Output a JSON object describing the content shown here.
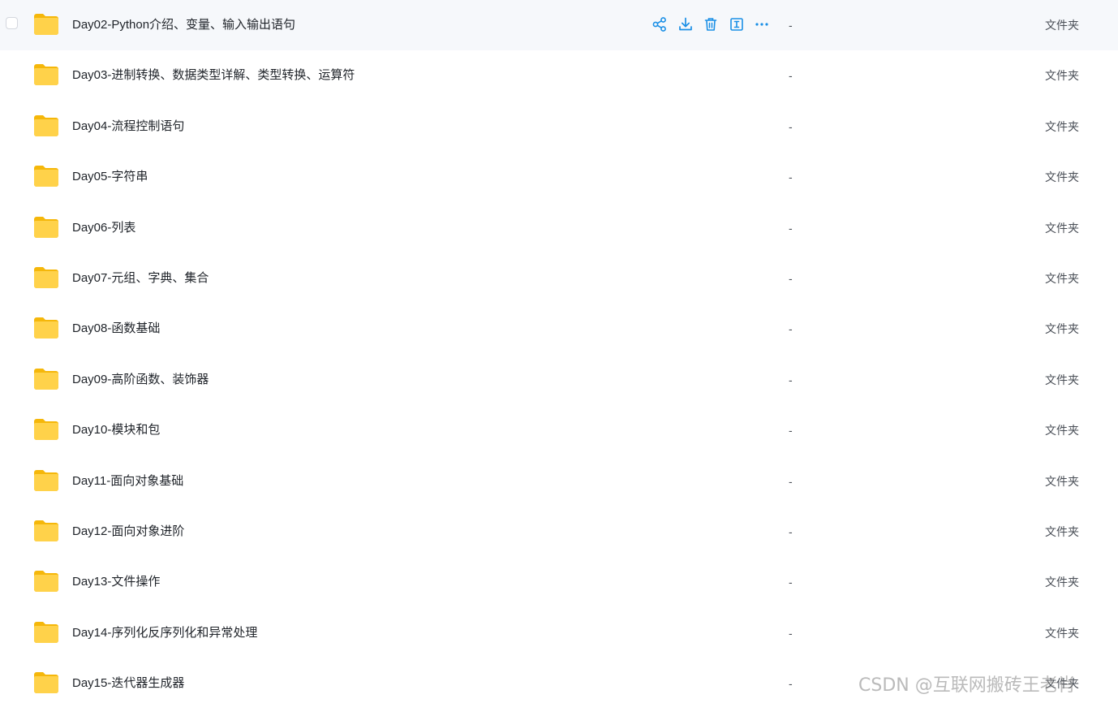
{
  "rows": [
    {
      "name": "Day02-Python介绍、变量、输入输出语句",
      "size": "-",
      "type": "文件夹"
    },
    {
      "name": "Day03-进制转换、数据类型详解、类型转换、运算符",
      "size": "-",
      "type": "文件夹"
    },
    {
      "name": "Day04-流程控制语句",
      "size": "-",
      "type": "文件夹"
    },
    {
      "name": "Day05-字符串",
      "size": "-",
      "type": "文件夹"
    },
    {
      "name": "Day06-列表",
      "size": "-",
      "type": "文件夹"
    },
    {
      "name": "Day07-元组、字典、集合",
      "size": "-",
      "type": "文件夹"
    },
    {
      "name": "Day08-函数基础",
      "size": "-",
      "type": "文件夹"
    },
    {
      "name": "Day09-高阶函数、装饰器",
      "size": "-",
      "type": "文件夹"
    },
    {
      "name": "Day10-模块和包",
      "size": "-",
      "type": "文件夹"
    },
    {
      "name": "Day11-面向对象基础",
      "size": "-",
      "type": "文件夹"
    },
    {
      "name": "Day12-面向对象进阶",
      "size": "-",
      "type": "文件夹"
    },
    {
      "name": "Day13-文件操作",
      "size": "-",
      "type": "文件夹"
    },
    {
      "name": "Day14-序列化反序列化和异常处理",
      "size": "-",
      "type": "文件夹"
    },
    {
      "name": "Day15-迭代器生成器",
      "size": "-",
      "type": "文件夹"
    }
  ],
  "hovered_row_actions": [
    "share-icon",
    "download-icon",
    "delete-icon",
    "rename-icon",
    "more-icon"
  ],
  "colors": {
    "accent": "#1a8fe6",
    "folder": "#ffc83d",
    "hover_bg": "#f6f8fb"
  },
  "watermark": "CSDN @互联网搬砖王老肖"
}
